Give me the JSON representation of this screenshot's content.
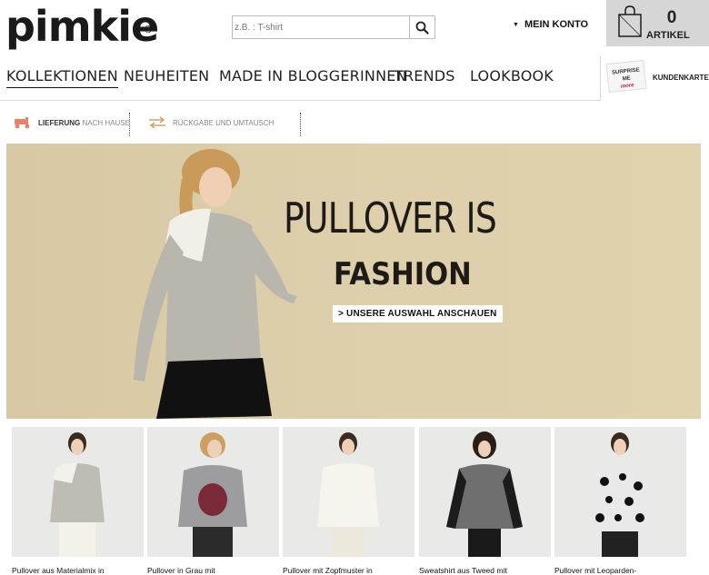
{
  "header": {
    "logo": "pimkie",
    "logo_reg": "®",
    "search_placeholder": "z.B. : T-shirt",
    "account_label": "MEIN KONTO",
    "cart_count": "0",
    "cart_label": "ARTIKEL"
  },
  "nav": {
    "items": [
      {
        "label": "KOLLEKTIONEN"
      },
      {
        "label": "NEUHEITEN"
      },
      {
        "label": "MADE IN BLOGGERINNEN"
      },
      {
        "label": "TRENDS"
      },
      {
        "label": "LOOKBOOK"
      }
    ],
    "kundenkarte_badge_top": "SURPRISE ME",
    "kundenkarte_badge_bottom": "more",
    "kundenkarte_label": "KUNDENKARTE"
  },
  "service": {
    "delivery_bold": "LIEFERUNG",
    "delivery_rest": "NACH HAUSE",
    "returns": "RÜCKGABE UND UMTAUSCH"
  },
  "banner": {
    "title_line1": "PULLOVER IS",
    "title_line2": "FASHION",
    "cta": "UNSERE AUSWAHL ANSCHAUEN",
    "cta_prefix": ">"
  },
  "products": [
    {
      "caption": "Pullover aus Materialmix in"
    },
    {
      "caption": "Pullover in Grau mit"
    },
    {
      "caption": "Pullover mit Zopfmuster in"
    },
    {
      "caption": "Sweatshirt aus Tweed mit"
    },
    {
      "caption": "Pullover mit Leoparden-"
    }
  ],
  "colors": {
    "banner_bg": "#dccdaa",
    "cart_bg": "#d6d6d6",
    "accent_pink": "#c2185b"
  }
}
